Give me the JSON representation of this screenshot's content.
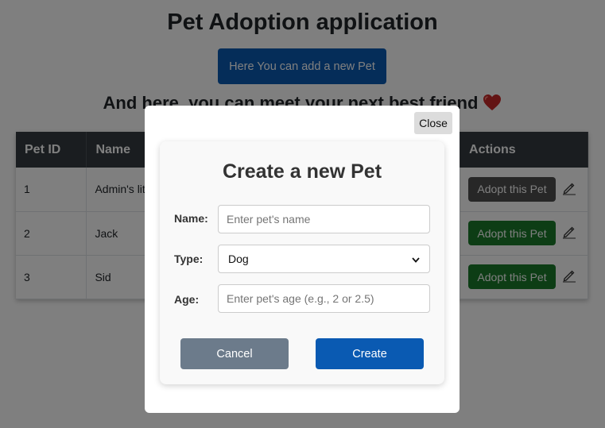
{
  "header": {
    "title": "Pet Adoption application",
    "add_button_label": "Here You can add a new Pet",
    "subtitle": "And here, you can meet your next best friend"
  },
  "table": {
    "columns": [
      "Pet ID",
      "Name",
      "",
      "Actions"
    ],
    "rows": [
      {
        "id": "1",
        "name": "Admin's little friend",
        "action": "Adopt this Pet",
        "action_color": "#4f4f4f"
      },
      {
        "id": "2",
        "name": "Jack",
        "action": "Adopt this Pet",
        "action_color": "#1a7a2a"
      },
      {
        "id": "3",
        "name": "Sid",
        "action": "Adopt this Pet",
        "action_color": "#1a7a2a"
      }
    ]
  },
  "modal": {
    "close_label": "Close",
    "title": "Create a new Pet",
    "fields": {
      "name": {
        "label": "Name:",
        "value": "",
        "placeholder": "Enter pet's name"
      },
      "type": {
        "label": "Type:",
        "selected": "Dog"
      },
      "age": {
        "label": "Age:",
        "value": "",
        "placeholder": "Enter pet's age (e.g., 2 or 2.5)"
      }
    },
    "cancel_label": "Cancel",
    "create_label": "Create"
  },
  "colors": {
    "primary": "#0a5ab2",
    "adopt_green": "#1a7a2a",
    "adopt_disabled": "#4f4f4f",
    "table_header": "#343a40",
    "cancel": "#6c7b8b",
    "heart": "#c62828"
  },
  "icons": {
    "heart": "heart-icon",
    "edit": "pencil-icon",
    "select_arrow": "chevron-down-icon"
  }
}
